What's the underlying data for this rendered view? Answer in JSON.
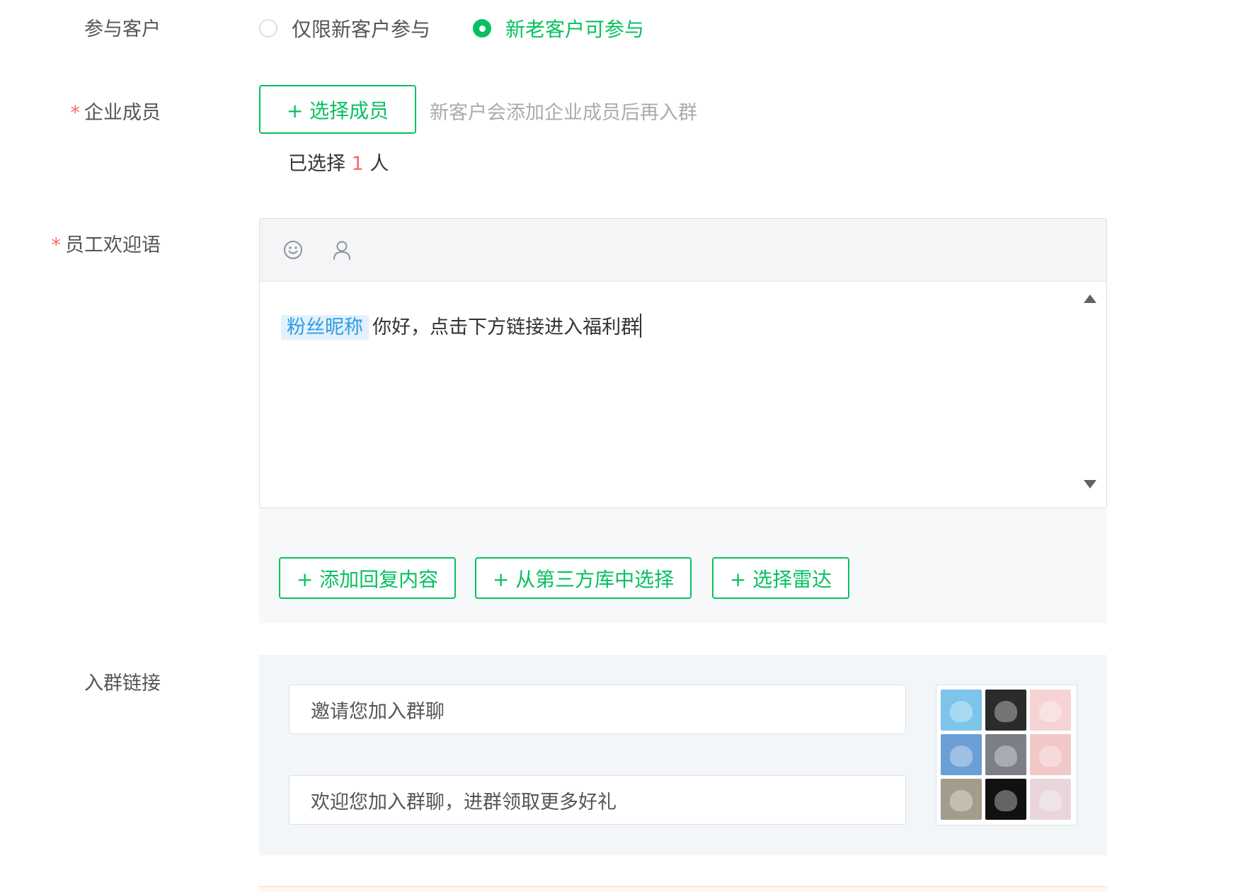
{
  "participants": {
    "label": "参与客户",
    "options": [
      {
        "label": "仅限新客户参与",
        "checked": false
      },
      {
        "label": "新老客户可参与",
        "checked": true
      }
    ]
  },
  "members": {
    "label": "企业成员",
    "required_mark": "*",
    "select_button": "+ 选择成员",
    "hint": "新客户会添加企业成员后再入群",
    "selected_prefix": "已选择",
    "selected_count": "1",
    "selected_suffix": "人"
  },
  "welcome": {
    "label": "员工欢迎语",
    "required_mark": "*",
    "tag": "粉丝昵称",
    "text": "你好，点击下方链接进入福利群",
    "toolbar_icons": [
      "emoji-icon",
      "user-icon"
    ]
  },
  "reply_buttons": {
    "add_reply": "+ 添加回复内容",
    "third_party": "+ 从第三方库中选择",
    "radar": "+ 选择雷达"
  },
  "group_link": {
    "label": "入群链接",
    "title_value": "邀请您加入群聊",
    "desc_value": "欢迎您加入群聊，进群领取更多好礼"
  },
  "colors": {
    "accent": "#07c160",
    "required": "#f56c6c",
    "tag_text": "#2e9be4",
    "tag_bg": "#e3f1fb",
    "avatar_tiles": [
      "#7cc4ea",
      "#2b2b2b",
      "#f6d3d3",
      "#6b9fd6",
      "#7c7f86",
      "#f2c7c7",
      "#a39b8c",
      "#111111",
      "#e9d6dc"
    ]
  }
}
